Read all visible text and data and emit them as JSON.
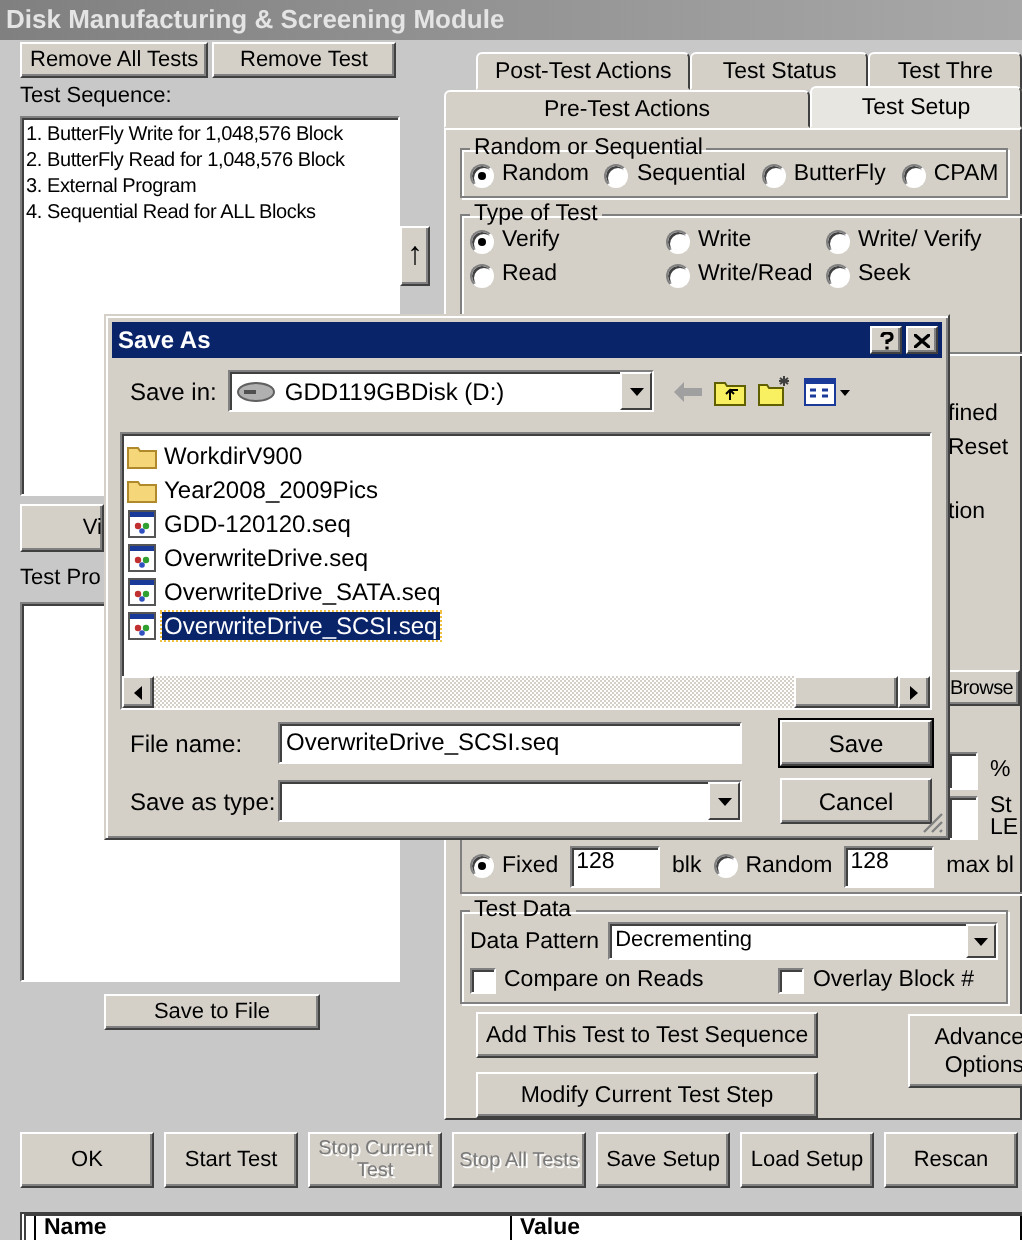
{
  "window": {
    "title": "Disk Manufacturing & Screening Module"
  },
  "sequence": {
    "buttons": [
      "Remove All Tests",
      "Remove Test"
    ],
    "label": "Test Sequence:",
    "items": [
      "1. ButterFly Write for 1,048,576 Block",
      "2. ButterFly Read for 1,048,576 Block",
      "3. External Program",
      "4. Sequential Read for ALL Blocks"
    ],
    "scroll_button": "↑"
  },
  "view_button": "Vi",
  "program_label": "Test Pro",
  "save_to_file": "Save to File",
  "tabs_row_1": [
    {
      "label": "Post-Test Actions",
      "selected": false
    },
    {
      "label": "Test Status",
      "selected": false
    },
    {
      "label": "Test Thre",
      "selected": false
    }
  ],
  "tabs_row_2": [
    {
      "label": "Pre-Test Actions",
      "selected": false
    },
    {
      "label": "Test Setup",
      "selected": true
    }
  ],
  "random_or_sequential": {
    "title": "Random or Sequential",
    "options": [
      {
        "label": "Random",
        "selected": true
      },
      {
        "label": "Sequential",
        "selected": false
      },
      {
        "label": "ButterFly",
        "selected": false
      },
      {
        "label": "CPAM",
        "selected": false
      }
    ]
  },
  "type_of_test": {
    "title": "Type of Test",
    "options": [
      {
        "label": "Verify",
        "selected": true
      },
      {
        "label": "Write",
        "selected": false
      },
      {
        "label": "Write/ Verify",
        "selected": false
      },
      {
        "label": "Read",
        "selected": false
      },
      {
        "label": "Write/Read",
        "selected": false
      },
      {
        "label": "Seek",
        "selected": false
      }
    ]
  },
  "side_texts": [
    "fined",
    "Reset",
    "tion"
  ],
  "browse_button": "Browse",
  "percent": "%",
  "lba_texts": [
    "St",
    "LE"
  ],
  "block_size": [
    {
      "label": "Fixed",
      "selected": true,
      "value": "128",
      "unit": "blk"
    },
    {
      "label": "Random",
      "selected": false,
      "value": "128",
      "unit": "max bl"
    }
  ],
  "test_data": {
    "title": "Test Data",
    "pattern_label": "Data Pattern",
    "pattern": "Decrementing",
    "checkboxes": [
      {
        "label": "Compare on Reads",
        "checked": false
      },
      {
        "label": "Overlay Block #",
        "checked": false
      }
    ]
  },
  "action_buttons": [
    "Add This Test to Test Sequence",
    "Modify Current Test Step"
  ],
  "advanced_button": [
    "Advance",
    "Options"
  ],
  "bottom_buttons": [
    {
      "label": "OK",
      "disabled": false
    },
    {
      "label": "Start Test",
      "disabled": false
    },
    {
      "label": "Stop Current Test",
      "disabled": true
    },
    {
      "label": "Stop All Tests",
      "disabled": true
    },
    {
      "label": "Save Setup",
      "disabled": false
    },
    {
      "label": "Load Setup",
      "disabled": false
    },
    {
      "label": "Rescan",
      "disabled": false
    }
  ],
  "table": {
    "columns": [
      "Name",
      "Value"
    ]
  },
  "dialog": {
    "title": "Save As",
    "save_in_label": "Save in:",
    "save_in": "GDD119GBDisk (D:)",
    "files": [
      {
        "name": "WorkdirV900",
        "kind": "folder",
        "selected": false
      },
      {
        "name": "Year2008_2009Pics",
        "kind": "folder",
        "selected": false
      },
      {
        "name": "GDD-120120.seq",
        "kind": "file",
        "selected": false
      },
      {
        "name": "OverwriteDrive.seq",
        "kind": "file",
        "selected": false
      },
      {
        "name": "OverwriteDrive_SATA.seq",
        "kind": "file",
        "selected": false
      },
      {
        "name": "OverwriteDrive_SCSI.seq",
        "kind": "file",
        "selected": true
      }
    ],
    "file_name_label": "File name:",
    "file_name": "OverwriteDrive_SCSI.seq",
    "type_label": "Save as type:",
    "buttons": [
      "Save",
      "Cancel"
    ]
  }
}
